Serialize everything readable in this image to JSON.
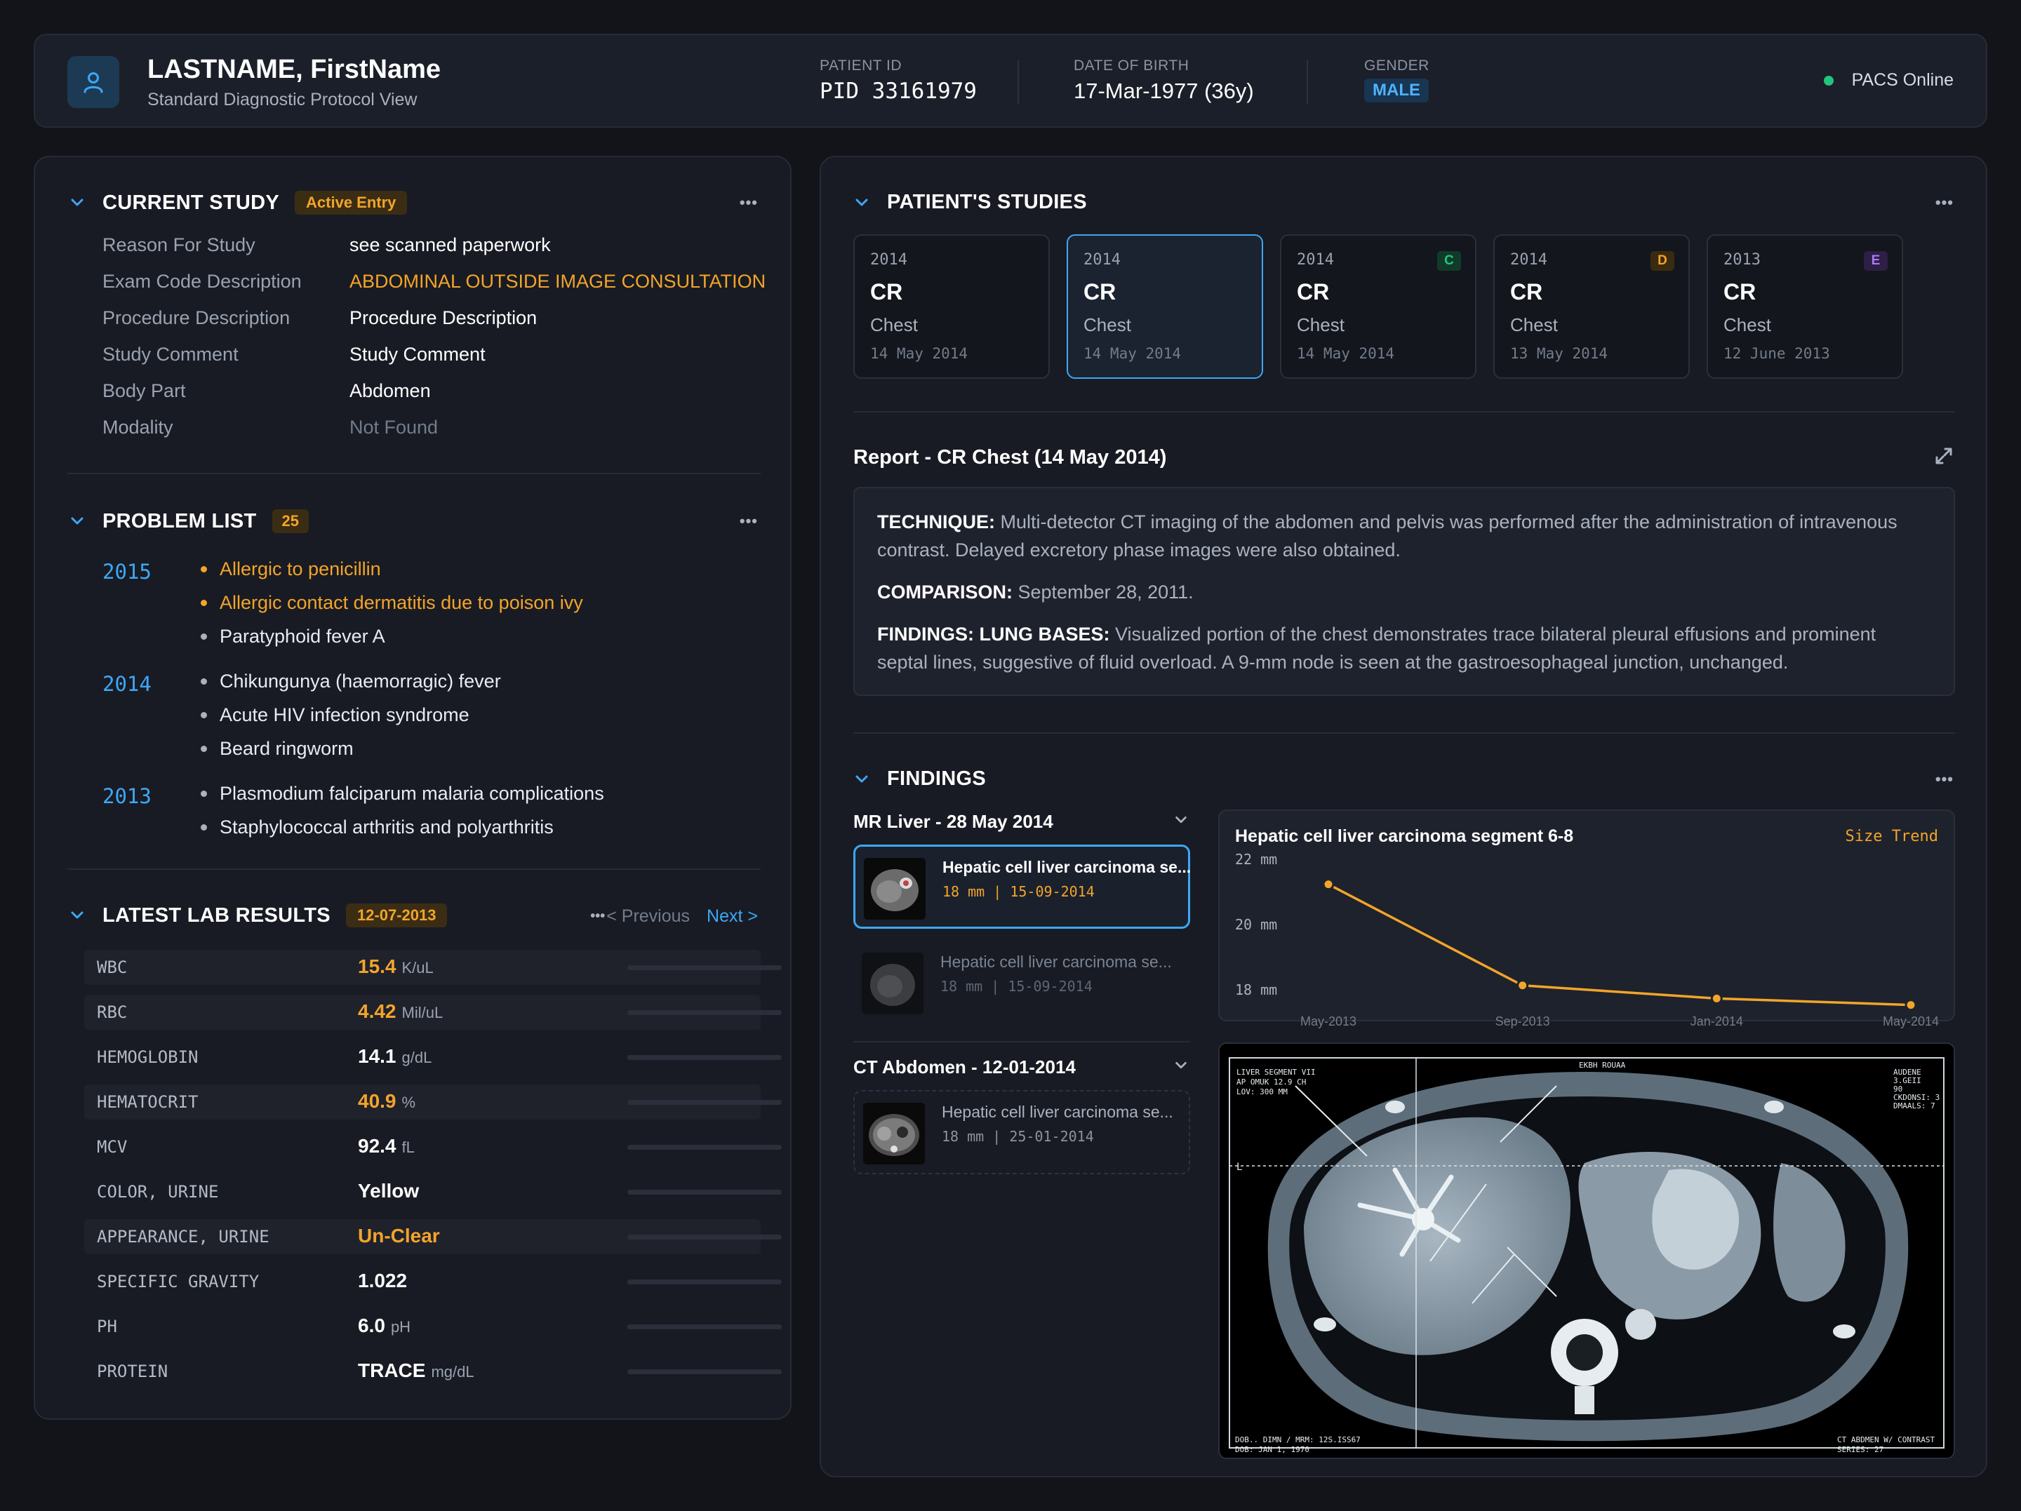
{
  "header": {
    "name": "LASTNAME, FirstName",
    "subtitle": "Standard Diagnostic Protocol View",
    "patient_id_label": "PATIENT ID",
    "patient_id": "PID 33161979",
    "dob_label": "DATE OF BIRTH",
    "dob": "17-Mar-1977 (36y)",
    "gender_label": "GENDER",
    "gender": "MALE",
    "status": "PACS Online",
    "status_color": "#22c47e"
  },
  "current_study": {
    "title": "CURRENT STUDY",
    "badge": "Active Entry",
    "menu": "•••",
    "rows": [
      {
        "label": "Reason For Study",
        "value": "see scanned paperwork"
      },
      {
        "label": "Exam Code Description",
        "value": "ABDOMINAL OUTSIDE IMAGE CONSULTATION"
      },
      {
        "label": "Procedure Description",
        "value": "Procedure Description"
      },
      {
        "label": "Study Comment",
        "value": "Study Comment"
      },
      {
        "label": "Body Part",
        "value": "Abdomen"
      },
      {
        "label": "Modality",
        "value": "Not Found"
      }
    ]
  },
  "problem_list": {
    "title": "PROBLEM LIST",
    "count": "25",
    "menu": "•••",
    "groups": [
      {
        "year": "2015",
        "items": [
          "Allergic to penicillin",
          "Allergic contact dermatitis due to poison ivy",
          "Paratyphoid fever A"
        ]
      },
      {
        "year": "2014",
        "items": [
          "Chikungunya (haemorragic) fever",
          "Acute HIV infection syndrome",
          "Beard ringworm"
        ]
      },
      {
        "year": "2013",
        "items": [
          "Plasmodium falciparum malaria complications",
          "Staphylococcal arthritis and polyarthritis"
        ]
      }
    ]
  },
  "lab_results": {
    "title": "LATEST LAB RESULTS",
    "date": "12-07-2013",
    "menu": "•••",
    "prev": "< Previous",
    "next": "Next >",
    "rows": [
      {
        "name": "WBC",
        "value": "15.4",
        "unit": "K/uL"
      },
      {
        "name": "RBC",
        "value": "4.42",
        "unit": "Mil/uL"
      },
      {
        "name": "HEMOGLOBIN",
        "value": "14.1",
        "unit": "g/dL"
      },
      {
        "name": "HEMATOCRIT",
        "value": "40.9",
        "unit": "%"
      },
      {
        "name": "MCV",
        "value": "92.4",
        "unit": "fL"
      },
      {
        "name": "COLOR, URINE",
        "value": "Yellow",
        "unit": ""
      },
      {
        "name": "APPEARANCE, URINE",
        "value": "Un-Clear",
        "unit": ""
      },
      {
        "name": "SPECIFIC GRAVITY",
        "value": "1.022",
        "unit": ""
      },
      {
        "name": "PH",
        "value": "6.0",
        "unit": "pH"
      },
      {
        "name": "PROTEIN",
        "value": "TRACE",
        "unit": "mg/dL"
      }
    ]
  },
  "studies": {
    "title": "PATIENT'S STUDIES",
    "menu": "•••",
    "cards": [
      {
        "year": "2014",
        "modality": "CR",
        "body_part": "Chest",
        "date": "14 May 2014",
        "tag": ""
      },
      {
        "year": "2014",
        "modality": "CR",
        "body_part": "Chest",
        "date": "14 May 2014",
        "tag": ""
      },
      {
        "year": "2014",
        "modality": "CR",
        "body_part": "Chest",
        "date": "14 May 2014",
        "tag": "C"
      },
      {
        "year": "2014",
        "modality": "CR",
        "body_part": "Chest",
        "date": "13 May 2014",
        "tag": "D"
      },
      {
        "year": "2013",
        "modality": "CR",
        "body_part": "Chest",
        "date": "12 June 2013",
        "tag": "E"
      }
    ]
  },
  "report": {
    "title": "Report - CR Chest (14 May 2014)",
    "technique_label": "TECHNIQUE:",
    "technique": "Multi-detector CT imaging of the abdomen and pelvis was performed after the administration of intravenous contrast. Delayed excretory phase images were also obtained.",
    "comparison_label": "COMPARISON:",
    "comparison": "September 28, 2011.",
    "findings_label": "FINDINGS: LUNG BASES:",
    "findings": "Visualized portion of the chest demonstrates trace bilateral pleural effusions and prominent septal lines, suggestive of fluid overload. A 9-mm node is seen at the gastroesophageal junction, unchanged."
  },
  "findings": {
    "title": "FINDINGS",
    "menu": "•••",
    "exam1": "MR Liver - 28 May 2014",
    "exam2": "CT Abdomen - 12-01-2014",
    "items": [
      {
        "title": "Hepatic cell liver carcinoma se...",
        "sub": "18 mm  |  15-09-2014"
      },
      {
        "title": "Hepatic cell liver carcinoma se...",
        "sub": "18 mm  |  15-09-2014"
      },
      {
        "title": "Hepatic cell liver carcinoma se...",
        "sub": "18 mm  |  25-01-2014"
      }
    ],
    "trend_title": "Hepatic cell liver carcinoma segment 6-8",
    "trend_label": "Size Trend"
  },
  "chart_data": {
    "type": "line",
    "title": "Hepatic cell liver carcinoma segment 6-8",
    "x": [
      "May-2013",
      "Sep-2013",
      "Jan-2014",
      "May-2014"
    ],
    "series": [
      {
        "name": "Size Trend",
        "values": [
          21.6,
          18.5,
          18.1,
          17.9
        ]
      }
    ],
    "y_ticks": [
      "22 mm",
      "20 mm",
      "18 mm"
    ],
    "ylim": [
      18,
      22
    ],
    "grid": false,
    "color": "#f3a42a"
  },
  "ct_overlay": {
    "top_left": [
      "LIVER SEGMENT VII",
      "AP OMUK 12.9 CH",
      "LOV: 300 MM"
    ],
    "top_center": "EKBH ROUAA",
    "top_right": [
      "AUDENE",
      "3.GEII",
      "90",
      "CKDONSI: 3",
      "DMAALS: 7"
    ],
    "bottom_left": [
      "DOB.. DIMN / MRM: 12S.ISS67",
      "DOB: JAN 1, 1970"
    ],
    "bottom_right": [
      "CT ABDMEN W/ CONTRAST",
      "SERIES: 27"
    ],
    "marker_l": "L"
  }
}
